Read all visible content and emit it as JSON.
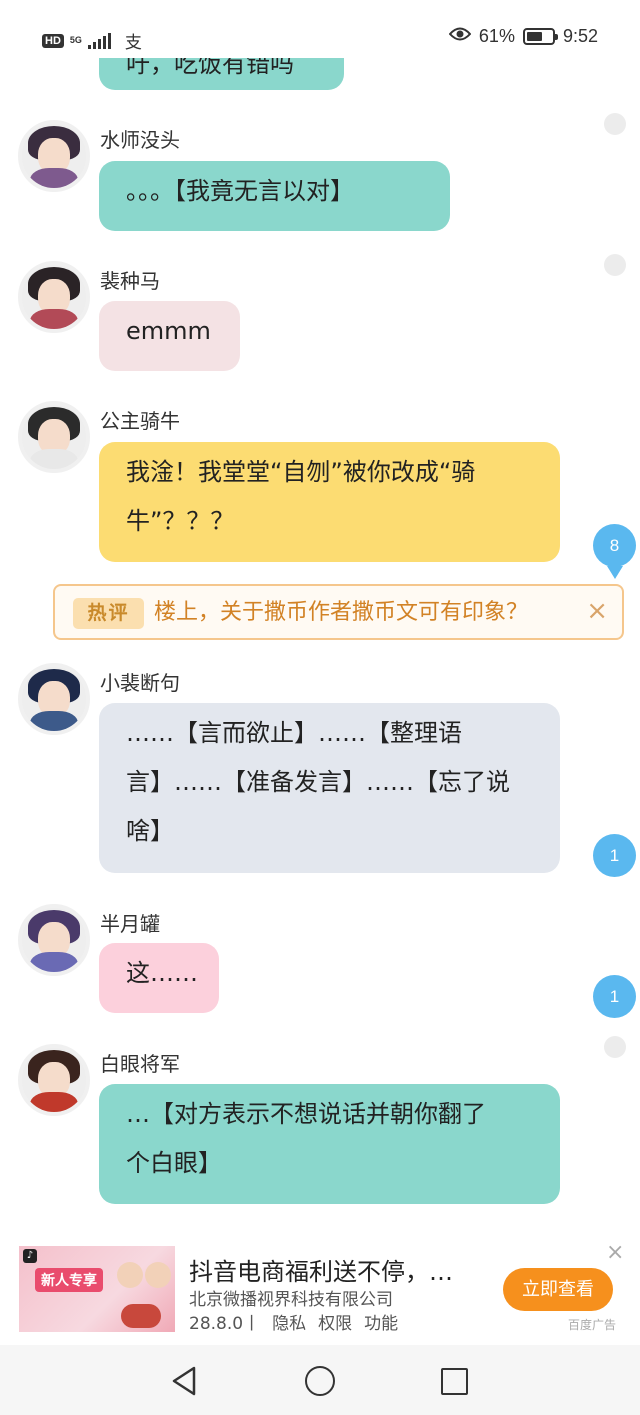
{
  "status_bar": {
    "hd": "HD",
    "network": "5G",
    "app_icon": "支",
    "battery_percent": "61%",
    "battery_level": 0.61,
    "time": "9:52",
    "icons": [
      "eye-icon",
      "battery-icon",
      "signal-icon"
    ]
  },
  "messages": [
    {
      "user": "",
      "text": "吁，吃饭有错吗",
      "color": "#8ad7cc"
    },
    {
      "user": "水师没头",
      "text": "。。。【我竟无言以对】",
      "color": "#8ad7cc"
    },
    {
      "user": "裴种马",
      "text": "emmm",
      "color": "#f4e2e4"
    },
    {
      "user": "公主骑牛",
      "text_lines": [
        "我淦！我堂堂“自刎”被你改成“骑",
        "牛”？？？"
      ],
      "color": "#fcdc72",
      "count": "8"
    },
    {
      "user": "小裴断句",
      "text_lines": [
        "……【言而欲止】……【整理语",
        "言】……【准备发言】……【忘了说",
        "啥】"
      ],
      "color": "#e3e7ee",
      "count": "1"
    },
    {
      "user": "半月罐",
      "text": "这……",
      "color": "#fcd0dc",
      "count": "1"
    },
    {
      "user": "白眼将军",
      "text_lines": [
        "…【对方表示不想说话并朝你翻了",
        "个白眼】"
      ],
      "color": "#8ad7cc"
    }
  ],
  "hot_comment": {
    "tag": "热评",
    "text": "楼上，关于撒币作者撒币文可有印象？",
    "close": "×"
  },
  "ad": {
    "title": "抖音电商福利送不停，…",
    "company": "北京微播视界科技有限公司",
    "version": "28.8.0丨",
    "privacy": "隐私",
    "permissions": "权限",
    "features": "功能",
    "button": "立即查看",
    "label": "百度广告",
    "close": "×",
    "thumb_text": "新人专享"
  },
  "nav": {
    "icons": [
      "back-icon",
      "home-icon",
      "recents-icon"
    ]
  }
}
